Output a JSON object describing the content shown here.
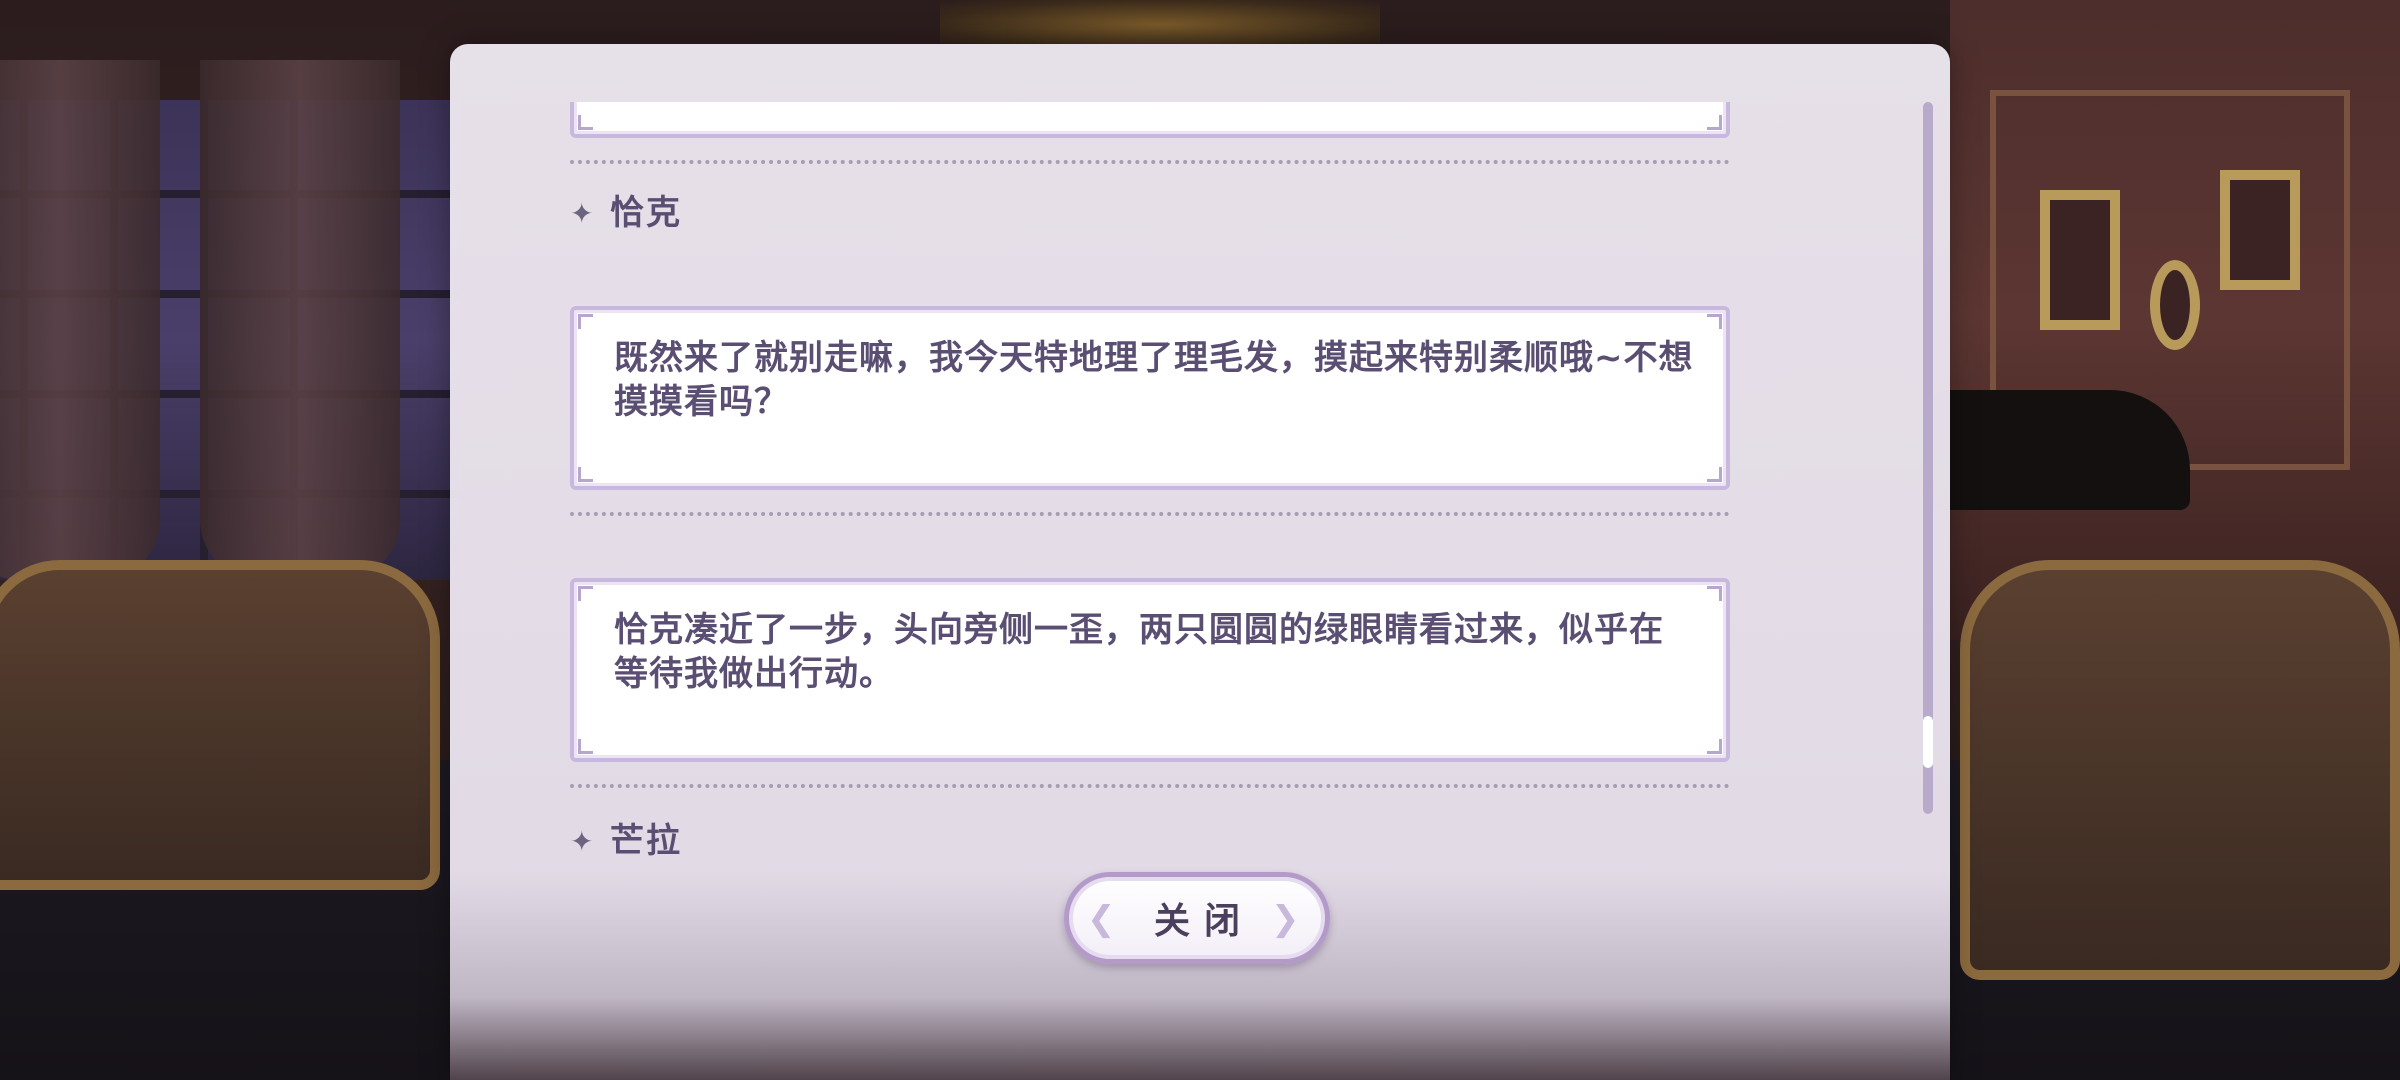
{
  "dialog": {
    "entries": [
      {
        "type": "text",
        "text": ""
      },
      {
        "type": "speaker",
        "name": "恰克"
      },
      {
        "type": "text",
        "text": "既然来了就别走嘛，我今天特地理了理毛发，摸起来特别柔顺哦~不想摸摸看吗？"
      },
      {
        "type": "text",
        "text": "恰克凑近了一步，头向旁侧一歪，两只圆圆的绿眼睛看过来，似乎在等待我做出行动。"
      },
      {
        "type": "speaker",
        "name": "芒拉"
      }
    ],
    "close_label": "关闭"
  },
  "icons": {
    "speaker_marker": "four-point-star-icon",
    "button_deco": "ornament-icon"
  },
  "colors": {
    "panel": "#ece6ef",
    "text": "#5a4f73",
    "border": "#c9b8dd",
    "button_border": "#b49ac9"
  }
}
